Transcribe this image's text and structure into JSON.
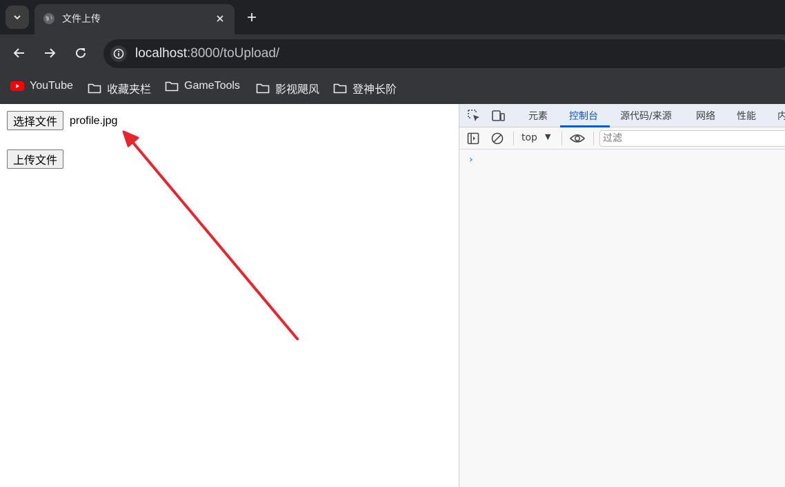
{
  "browser": {
    "tab_title": "文件上传",
    "url_host": "localhost",
    "url_rest": ":8000/toUpload/",
    "bookmarks": [
      {
        "label": "YouTube",
        "icon": "youtube-icon"
      },
      {
        "label": "收藏夹栏",
        "icon": "folder-icon"
      },
      {
        "label": "GameTools",
        "icon": "folder-icon"
      },
      {
        "label": "影视飓风",
        "icon": "folder-icon"
      },
      {
        "label": "登神长阶",
        "icon": "folder-icon"
      }
    ]
  },
  "page": {
    "choose_file_label": "选择文件",
    "file_name": "profile.jpg",
    "upload_label": "上传文件"
  },
  "devtools": {
    "tabs": [
      "元素",
      "控制台",
      "源代码/来源",
      "网络",
      "性能",
      "内"
    ],
    "active_tab": "控制台",
    "context": "top",
    "filter_placeholder": "过滤",
    "prompt": "›"
  },
  "colors": {
    "annotation_arrow": "#e8242f",
    "devtools_accent": "#0b57d0"
  }
}
